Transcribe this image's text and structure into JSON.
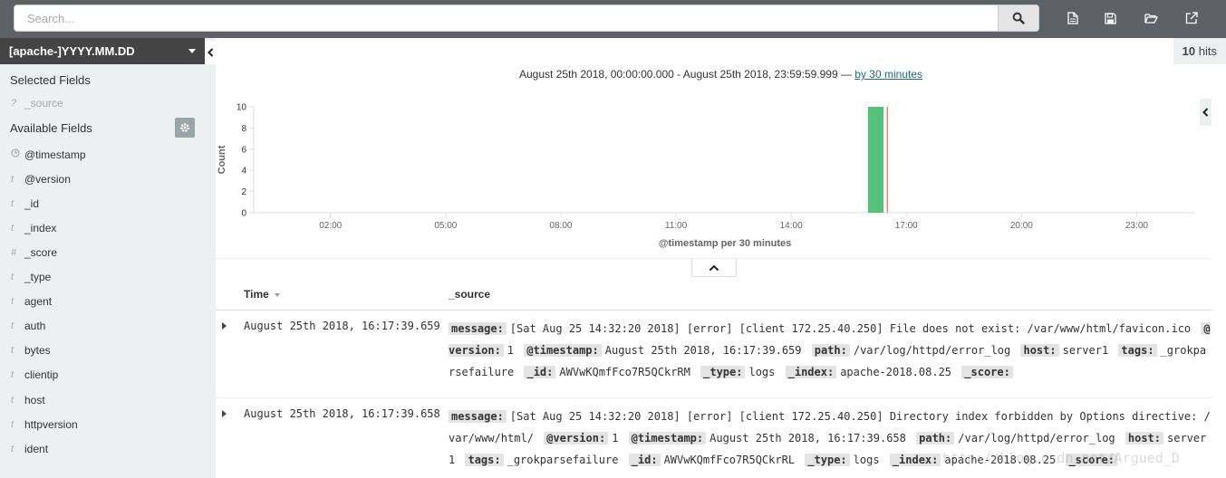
{
  "search": {
    "placeholder": "Search..."
  },
  "toolbar": {
    "icons": [
      "new-search-icon",
      "save-search-icon",
      "open-search-icon",
      "share-icon"
    ]
  },
  "sidebar": {
    "index_pattern": "[apache-]YYYY.MM.DD",
    "selected_heading": "Selected Fields",
    "selected_fields": [
      {
        "type": "?",
        "name": "_source"
      }
    ],
    "available_heading": "Available Fields",
    "available_fields": [
      {
        "type": "clock",
        "name": "@timestamp"
      },
      {
        "type": "t",
        "name": "@version"
      },
      {
        "type": "t",
        "name": "_id"
      },
      {
        "type": "t",
        "name": "_index"
      },
      {
        "type": "#",
        "name": "_score"
      },
      {
        "type": "t",
        "name": "_type"
      },
      {
        "type": "t",
        "name": "agent"
      },
      {
        "type": "t",
        "name": "auth"
      },
      {
        "type": "t",
        "name": "bytes"
      },
      {
        "type": "t",
        "name": "clientip"
      },
      {
        "type": "t",
        "name": "host"
      },
      {
        "type": "t",
        "name": "httpversion"
      },
      {
        "type": "t",
        "name": "ident"
      }
    ]
  },
  "hits": {
    "count": "10",
    "label": "hits"
  },
  "range": {
    "text": "August 25th 2018, 00:00:00.000 - August 25th 2018, 23:59:59.999 —",
    "interval_link": "by 30 minutes"
  },
  "chart_data": {
    "type": "bar",
    "title": "",
    "xlabel": "@timestamp per 30 minutes",
    "ylabel": "Count",
    "ylim": [
      0,
      10
    ],
    "y_ticks": [
      0,
      2,
      4,
      6,
      8,
      10
    ],
    "x_tick_labels": [
      "02:00",
      "05:00",
      "08:00",
      "11:00",
      "14:00",
      "17:00",
      "20:00",
      "23:00"
    ],
    "x_tick_hours": [
      2,
      5,
      8,
      11,
      14,
      17,
      20,
      23
    ],
    "xlim_hours": [
      0,
      24.5
    ],
    "bars": [
      {
        "start_hour": 16.0,
        "end_hour": 16.5,
        "value": 10
      }
    ],
    "now_marker_hour": 16.27,
    "bar_color": "#57c17b",
    "marker_color": "#e7664c"
  },
  "table": {
    "time_header": "Time",
    "source_header": "_source",
    "rows": [
      {
        "time": "August 25th 2018, 16:17:39.659",
        "fields": [
          {
            "k": "message:",
            "v": "[Sat Aug 25 14:32:20 2018] [error] [client 172.25.40.250] File does not exist: /var/www/html/favicon.ico"
          },
          {
            "k": "@version:",
            "v": "1"
          },
          {
            "k": "@timestamp:",
            "v": "August 25th 2018, 16:17:39.659"
          },
          {
            "k": "path:",
            "v": "/var/log/httpd/error_log"
          },
          {
            "k": "host:",
            "v": "server1"
          },
          {
            "k": "tags:",
            "v": "_grokparsefailure"
          },
          {
            "k": "_id:",
            "v": "AWVwKQmfFco7R5QCkrRM"
          },
          {
            "k": "_type:",
            "v": "logs"
          },
          {
            "k": "_index:",
            "v": "apache-2018.08.25"
          },
          {
            "k": "_score:",
            "v": ""
          }
        ]
      },
      {
        "time": "August 25th 2018, 16:17:39.658",
        "fields": [
          {
            "k": "message:",
            "v": "[Sat Aug 25 14:32:20 2018] [error] [client 172.25.40.250] Directory index forbidden by Options directive: /var/www/html/"
          },
          {
            "k": "@version:",
            "v": "1"
          },
          {
            "k": "@timestamp:",
            "v": "August 25th 2018, 16:17:39.658"
          },
          {
            "k": "path:",
            "v": "/var/log/httpd/error_log"
          },
          {
            "k": "host:",
            "v": "server1"
          },
          {
            "k": "tags:",
            "v": "_grokparsefailure"
          },
          {
            "k": "_id:",
            "v": "AWVwKQmfFco7R5QCkrRL"
          },
          {
            "k": "_type:",
            "v": "logs"
          },
          {
            "k": "_index:",
            "v": "apache-2018.08.25"
          },
          {
            "k": "_score:",
            "v": ""
          }
        ]
      }
    ]
  },
  "watermark": "http://blog.csdn.net/Argued_D"
}
